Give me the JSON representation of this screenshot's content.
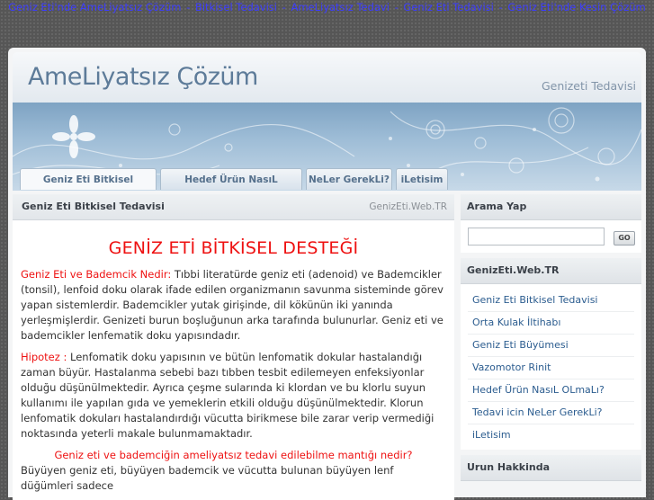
{
  "top_links": [
    "Geniz Eti'nde AmeLiyatsız Çözüm",
    "Bitkisel Tedavisi",
    "AmeLiyatsız Tedavi",
    "Geniz Eti Tedavisi",
    "Geniz Eti'nde Kesin Çözüm"
  ],
  "top_sep": "-",
  "header": {
    "title": "AmeLiyatsız Çözüm",
    "tagline": "Genizeti Tedavisi"
  },
  "nav": {
    "tabs": [
      {
        "label": "Geniz Eti Bitkisel Tedavisi"
      },
      {
        "label": "Hedef Ürün NasıL OLmaLı?"
      },
      {
        "label": "NeLer GerekLi?"
      },
      {
        "label": "iLetisim"
      }
    ]
  },
  "main": {
    "head_title": "Geniz Eti Bitkisel Tedavisi",
    "head_source": "GenizEti.Web.TR",
    "heading": "GENİZ ETİ BİTKİSEL DESTEĞİ",
    "p1_label": "Geniz Eti ve Bademcik Nedir:",
    "p1_text": " Tıbbi literatürde geniz eti (adenoid) ve Bademcikler (tonsil), lenfoid doku olarak ifade edilen organizmanın savunma sisteminde görev yapan sistemlerdir. Bademcikler yutak girişinde, dil kökünün iki yanında yerleşmişlerdir. Genizeti burun boşluğunun arka tarafında bulunurlar. Geniz eti ve bademcikler lenfematik doku yapısındadır.",
    "p2_label": "Hipotez :",
    "p2_text": " Lenfomatik doku yapısının ve bütün lenfomatik dokular hastalandığı zaman büyür. Hastalanma sebebi bazı tıbben tesbit edilemeyen enfeksiyonlar olduğu düşünülmektedir. Ayrıca çeşme sularında ki klordan ve bu klorlu suyun kullanımı ile yapılan gıda ve yemeklerin etkili olduğu düşünülmektedir. Klorun lenfomatik dokuları hastalandırdığı vücutta birikmese bile zarar verip vermediği noktasında yeterli makale bulunmamaktadır.",
    "question": "Geniz eti ve bademciğin ameliyatsız tedavi edilebilme mantığı nedir?",
    "p3_text": "Büyüyen geniz eti, büyüyen bademcik ve vücutta bulunan büyüyen lenf düğümleri sadece"
  },
  "sidebar": {
    "search": {
      "title": "Arama Yap",
      "placeholder": "",
      "button": "GO"
    },
    "links_box": {
      "title": "GenizEti.Web.TR",
      "items": [
        {
          "label": "Geniz Eti Bitkisel Tedavisi"
        },
        {
          "label": "Orta Kulak İltihabı"
        },
        {
          "label": "Geniz Eti Büyümesi"
        },
        {
          "label": "Vazomotor Rinit"
        },
        {
          "label": "Hedef Ürün NasıL OLmaLı?"
        },
        {
          "label": "Tedavi icin NeLer GerekLi?"
        },
        {
          "label": "iLetisim"
        }
      ]
    },
    "about_box": {
      "title": "Urun Hakkinda"
    }
  },
  "colors": {
    "accent_red": "#ee1111",
    "link_blue": "#2b5c8f",
    "top_link": "#3d3dff",
    "title_blue": "#5d7b99"
  }
}
